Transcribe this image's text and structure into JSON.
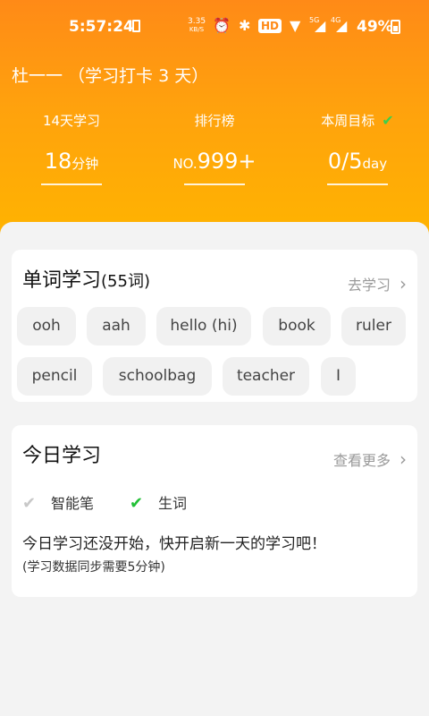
{
  "statusbar": {
    "time": "5:57:24",
    "speed_value": "3.35",
    "speed_unit": "KB/S",
    "hd": "HD",
    "net1": "5G",
    "net2": "4G",
    "battery": "49%"
  },
  "header": {
    "user_line": "杜一一 （学习打卡 3 天）",
    "stats": [
      {
        "label": "14天学习",
        "value": "18",
        "unit": "分钟"
      },
      {
        "label": "排行榜",
        "prefix": "NO.",
        "value": "999+"
      },
      {
        "label": "本周目标",
        "value": "0/5",
        "unit": "day"
      }
    ]
  },
  "vocab_card": {
    "title": "单词学习",
    "count": "(55词)",
    "action": "去学习",
    "words": [
      "ooh",
      "aah",
      "hello (hi)",
      "book",
      "ruler",
      "pencil",
      "schoolbag",
      "teacher",
      "I"
    ]
  },
  "today_card": {
    "title": "今日学习",
    "action": "查看更多",
    "filters": [
      {
        "label": "智能笔",
        "checked": false
      },
      {
        "label": "生词",
        "checked": true
      }
    ],
    "message": "今日学习还没开始，快开启新一天的学习吧！",
    "note": "(学习数据同步需要5分钟)"
  },
  "colors": {
    "header_top": "#ff8a17",
    "header_bottom": "#ffb400",
    "highlight": "#ffe57a",
    "check_green": "#22c036"
  }
}
